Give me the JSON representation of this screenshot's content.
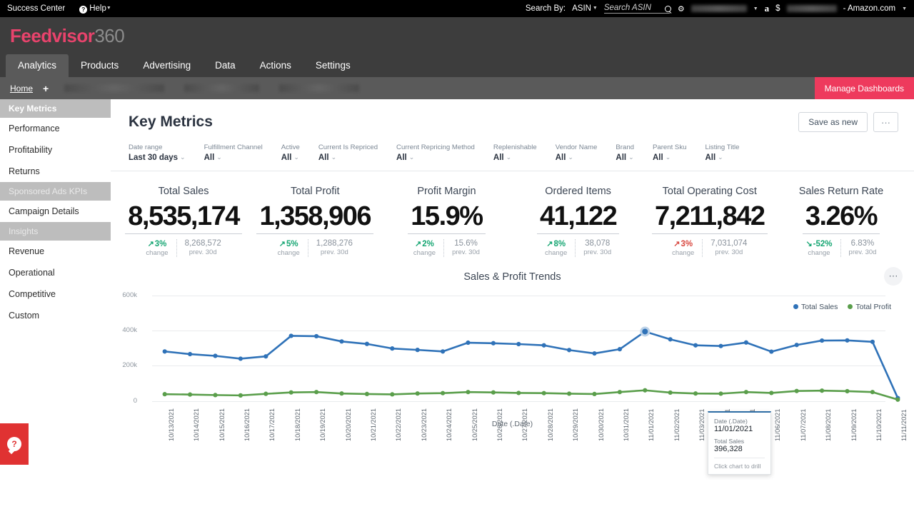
{
  "topbar": {
    "success_center": "Success Center",
    "help": "Help",
    "help_icon": "question-circle-icon",
    "search_by_label": "Search By:",
    "search_by_value": "ASIN",
    "search_placeholder": "Search ASIN",
    "search_value": "",
    "search_icon": "search-icon",
    "gear_icon": "gear-icon",
    "amazon_glyph": "a",
    "currency": "$",
    "marketplace": "- Amazon.com"
  },
  "logo": {
    "brand": "Feedvisor",
    "suffix": "360"
  },
  "mainnav": {
    "items": [
      {
        "label": "Analytics",
        "active": true
      },
      {
        "label": "Products",
        "active": false
      },
      {
        "label": "Advertising",
        "active": false
      },
      {
        "label": "Data",
        "active": false
      },
      {
        "label": "Actions",
        "active": false
      },
      {
        "label": "Settings",
        "active": false
      }
    ]
  },
  "tabbar": {
    "home": "Home",
    "add": "+",
    "manage_dashboards": "Manage Dashboards"
  },
  "sidebar": {
    "groups": [
      {
        "header": "Key Metrics",
        "header_style": "active",
        "items": [
          "Performance",
          "Profitability",
          "Returns"
        ]
      },
      {
        "header": "Sponsored Ads KPIs",
        "header_style": "muted",
        "items": [
          "Campaign Details"
        ]
      },
      {
        "header": "Insights",
        "header_style": "muted",
        "items": [
          "Revenue",
          "Operational",
          "Competitive",
          "Custom"
        ]
      }
    ],
    "help_badge": "?"
  },
  "page": {
    "title": "Key Metrics",
    "save_as_new": "Save as new",
    "more": "···"
  },
  "filters": [
    {
      "label": "Date range",
      "value": "Last 30 days"
    },
    {
      "label": "Fulfillment Channel",
      "value": "All"
    },
    {
      "label": "Active",
      "value": "All"
    },
    {
      "label": "Current Is Repriced",
      "value": "All"
    },
    {
      "label": "Current Repricing Method",
      "value": "All"
    },
    {
      "label": "Replenishable",
      "value": "All"
    },
    {
      "label": "Vendor Name",
      "value": "All"
    },
    {
      "label": "Brand",
      "value": "All"
    },
    {
      "label": "Parent Sku",
      "value": "All"
    },
    {
      "label": "Listing Title",
      "value": "All"
    }
  ],
  "kpis": [
    {
      "title": "Total Sales",
      "value": "8,535,174",
      "change": "3%",
      "direction": "up",
      "tone": "good",
      "change_label": "change",
      "prev": "8,268,572",
      "prev_label": "prev. 30d"
    },
    {
      "title": "Total Profit",
      "value": "1,358,906",
      "change": "5%",
      "direction": "up",
      "tone": "good",
      "change_label": "change",
      "prev": "1,288,276",
      "prev_label": "prev. 30d"
    },
    {
      "title": "Profit Margin",
      "value": "15.9%",
      "change": "2%",
      "direction": "up",
      "tone": "good",
      "change_label": "change",
      "prev": "15.6%",
      "prev_label": "prev. 30d"
    },
    {
      "title": "Ordered Items",
      "value": "41,122",
      "change": "8%",
      "direction": "up",
      "tone": "good",
      "change_label": "change",
      "prev": "38,078",
      "prev_label": "prev. 30d"
    },
    {
      "title": "Total Operating Cost",
      "value": "7,211,842",
      "change": "3%",
      "direction": "up",
      "tone": "bad",
      "change_label": "change",
      "prev": "7,031,074",
      "prev_label": "prev. 30d"
    },
    {
      "title": "Sales Return Rate",
      "value": "3.26%",
      "change": "-52%",
      "direction": "down",
      "tone": "good",
      "change_label": "change",
      "prev": "6.83%",
      "prev_label": "prev. 30d"
    }
  ],
  "tooltip": {
    "date_key": "Date (.Date)",
    "date_value": "11/01/2021",
    "metric_key": "Total Sales",
    "metric_value": "396,328",
    "footer": "Click chart to drill"
  },
  "chart_data": {
    "type": "line",
    "title": "Sales & Profit Trends",
    "xlabel": "Date (.Date)",
    "ylabel": "",
    "ylim": [
      0,
      650000
    ],
    "yticks": [
      0,
      200000,
      400000,
      600000
    ],
    "ytick_labels": [
      "0",
      "200k",
      "400k",
      "600k"
    ],
    "grid": true,
    "legend_position": "top-right",
    "colors": {
      "total_sales": "#2f72b8",
      "total_profit": "#5a9e4b"
    },
    "categories": [
      "10/13/2021",
      "10/14/2021",
      "10/15/2021",
      "10/16/2021",
      "10/17/2021",
      "10/18/2021",
      "10/19/2021",
      "10/20/2021",
      "10/21/2021",
      "10/22/2021",
      "10/23/2021",
      "10/24/2021",
      "10/25/2021",
      "10/26/2021",
      "10/27/2021",
      "10/28/2021",
      "10/29/2021",
      "10/30/2021",
      "10/31/2021",
      "11/01/2021",
      "11/02/2021",
      "11/03/2021",
      "11/04/2021",
      "11/05/2021",
      "11/06/2021",
      "11/07/2021",
      "11/08/2021",
      "11/09/2021",
      "11/10/2021",
      "11/11/2021"
    ],
    "series": [
      {
        "name": "Total Sales",
        "color": "#2f72b8",
        "values": [
          283000,
          268000,
          258000,
          242000,
          255000,
          372000,
          370000,
          340000,
          326000,
          300000,
          292000,
          283000,
          333000,
          330000,
          325000,
          318000,
          291000,
          272000,
          296000,
          396328,
          352000,
          318000,
          314000,
          334000,
          282000,
          320000,
          345000,
          346000,
          338000,
          18000
        ]
      },
      {
        "name": "Total Profit",
        "color": "#5a9e4b",
        "values": [
          40000,
          38000,
          35000,
          33000,
          42000,
          50000,
          52000,
          44000,
          41000,
          39000,
          44000,
          46000,
          52000,
          50000,
          47000,
          46000,
          43000,
          41000,
          52000,
          62000,
          49000,
          44000,
          43000,
          52000,
          47000,
          58000,
          60000,
          57000,
          52000,
          9000
        ]
      }
    ],
    "highlight_index": 19
  }
}
